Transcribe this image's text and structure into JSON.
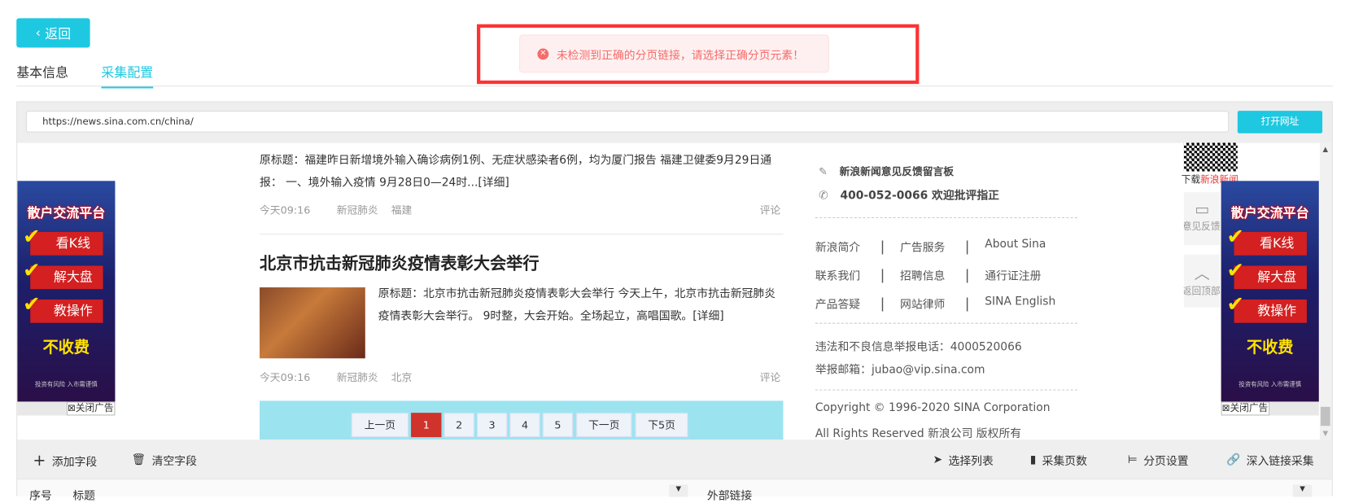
{
  "header": {
    "back_label": "返回",
    "tabs": [
      {
        "label": "基本信息"
      },
      {
        "label": "采集配置"
      }
    ]
  },
  "toast": {
    "message": "未检测到正确的分页链接，请选择正确分页元素！"
  },
  "browser": {
    "url": "https://news.sina.com.cn/china/",
    "open_label": "打开网址"
  },
  "articles": [
    {
      "summary": "原标题：福建昨日新增境外输入确诊病例1例、无症状感染者6例，均为厦门报告 福建卫健委9月29日通报： 一、境外输入疫情 9月28日0—24时...[详细]",
      "time": "今天09:16",
      "tag1": "新冠肺炎",
      "tag2": "福建",
      "comment": "评论"
    },
    {
      "title": "北京市抗击新冠肺炎疫情表彰大会举行",
      "summary": "原标题：北京市抗击新冠肺炎疫情表彰大会举行 今天上午，北京市抗击新冠肺炎疫情表彰大会举行。 9时整，大会开始。全场起立，高唱国歌。[详细]",
      "time": "今天09:16",
      "tag1": "新冠肺炎",
      "tag2": "北京",
      "comment": "评论"
    }
  ],
  "pagination": {
    "prev": "上一页",
    "pages": [
      "1",
      "2",
      "3",
      "4",
      "5"
    ],
    "current": "1",
    "next": "下一页",
    "next5": "下5页"
  },
  "right": {
    "feedback": "新浪新闻意见反馈留言板",
    "phone": "400-052-0066 欢迎批评指正",
    "links": [
      [
        "新浪简介",
        "广告服务",
        "About Sina"
      ],
      [
        "联系我们",
        "招聘信息",
        "通行证注册"
      ],
      [
        "产品答疑",
        "网站律师",
        "SINA English"
      ]
    ],
    "report_phone": "违法和不良信息举报电话：4000520066",
    "report_email": "举报邮箱：jubao@vip.sina.com",
    "copyright": "Copyright © 1996-2020 SINA Corporation",
    "rights": "All Rights Reserved 新浪公司 版权所有"
  },
  "qr": {
    "download": "下载",
    "app": "新浪新闻"
  },
  "side": {
    "feedback": "意见反馈",
    "top": "返回顶部"
  },
  "ad": {
    "headline": "散户交流平台",
    "items": [
      "看K线",
      "解大盘",
      "教操作"
    ],
    "free": "不收费",
    "risk": "投资有风险 入市需谨慎",
    "close": "⊠关闭广告"
  },
  "toolbar": {
    "add_field": "添加字段",
    "clear_fields": "清空字段",
    "select_list": "选择列表",
    "collect_pages": "采集页数",
    "pagination_settings": "分页设置",
    "deep_link": "深入链接采集"
  },
  "table": {
    "col_index": "序号",
    "col_title": "标题",
    "col_link": "外部链接"
  }
}
